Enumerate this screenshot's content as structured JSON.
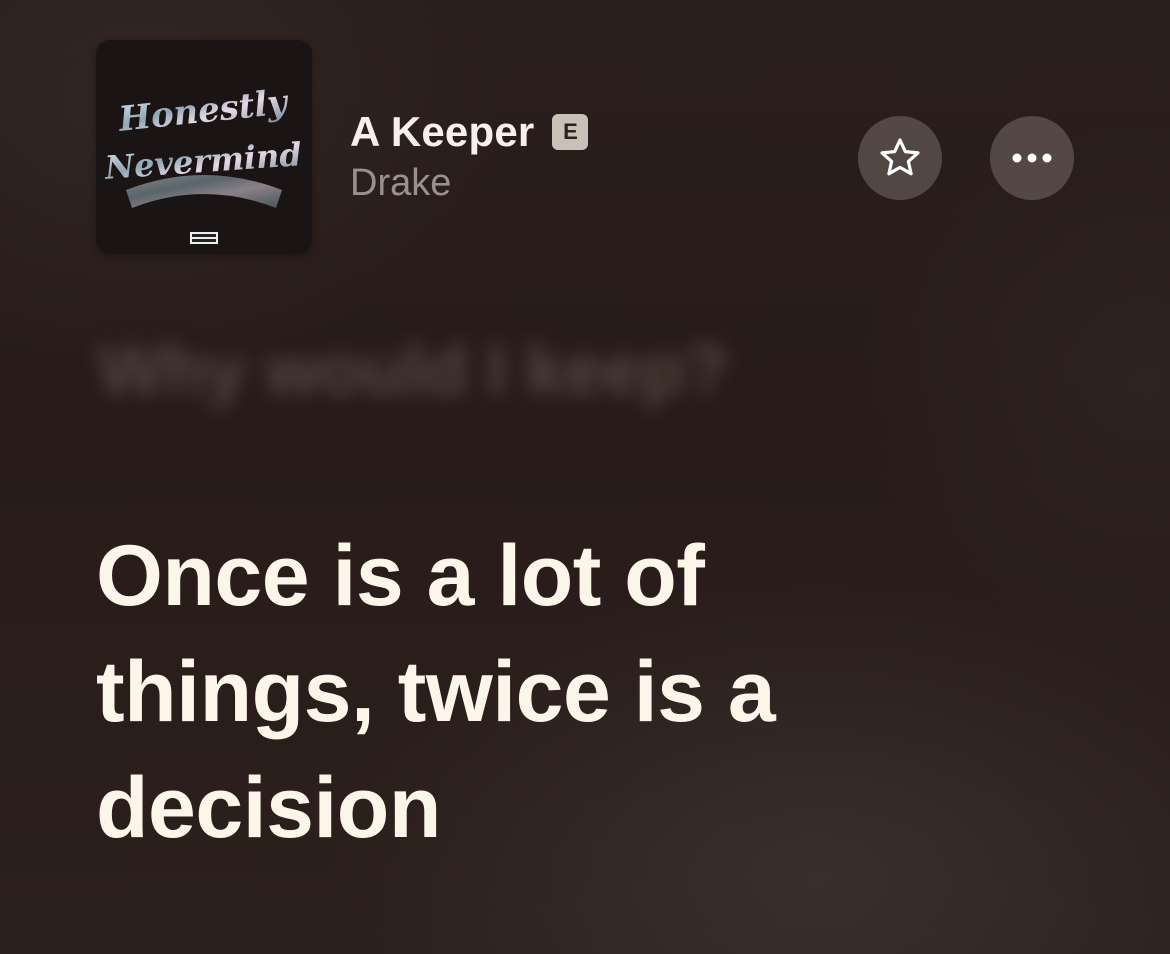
{
  "track": {
    "title": "A Keeper",
    "explicit_badge": "E",
    "artist": "Drake"
  },
  "album_art": {
    "cover_text": "Honestly Nevermind",
    "parental_advisory": "PARENTAL ADVISORY EXPLICIT CONTENT"
  },
  "actions": {
    "favorite_icon": "star-icon",
    "more_icon": "ellipsis-icon"
  },
  "lyrics": {
    "previous_line": "Why would I keep?",
    "current_line": "Once is a lot of things, twice is a decision"
  },
  "colors": {
    "background": "#2a1e1c",
    "lyric_active": "#fbf5ea",
    "artist_text": "#9b918a",
    "badge_bg": "#c9c1b8"
  }
}
